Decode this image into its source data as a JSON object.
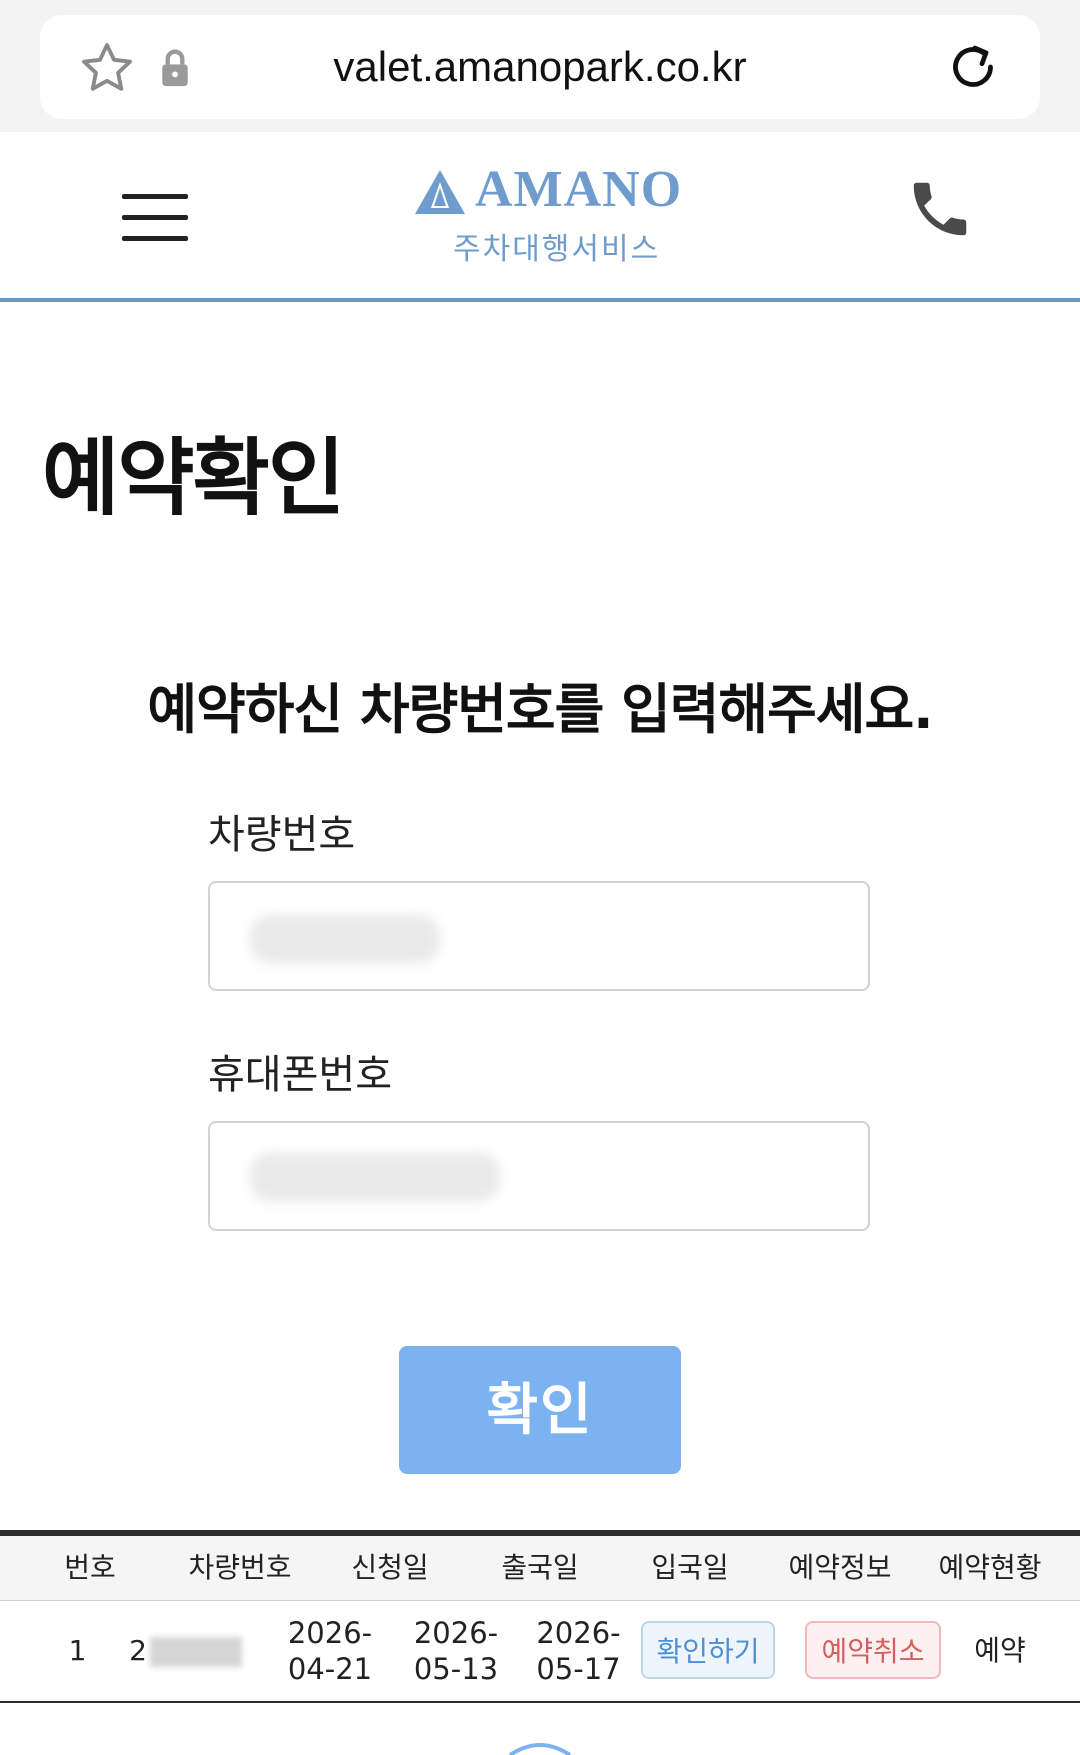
{
  "browser": {
    "url": "valet.amanopark.co.kr",
    "icons": [
      "star-icon",
      "lock-icon",
      "reload-icon"
    ]
  },
  "header": {
    "brand": "AMANO",
    "subtitle": "주차대행서비스",
    "icons": [
      "menu-icon",
      "phone-icon"
    ],
    "brand_color": "#6f9ccc",
    "divider_color": "#6e98c0"
  },
  "page": {
    "title": "예약확인",
    "instruction": "예약하신 차량번호를 입력해주세요."
  },
  "form": {
    "car_number": {
      "label": "차량번호",
      "value": ""
    },
    "phone_number": {
      "label": "휴대폰번호",
      "value": ""
    },
    "submit_label": "확인",
    "submit_color": "#7cb2f0"
  },
  "table": {
    "headers": [
      "번호",
      "차량번호",
      "신청일",
      "출국일",
      "입국일",
      "예약정보",
      "예약현황"
    ],
    "rows": [
      {
        "no": "1",
        "car_number": "2",
        "applied_date": "2026-04-21",
        "departure_date": "2026-05-13",
        "arrival_date": "2026-05-17",
        "info_button": "확인하기",
        "cancel_button": "예약취소",
        "status": "예약"
      }
    ]
  }
}
